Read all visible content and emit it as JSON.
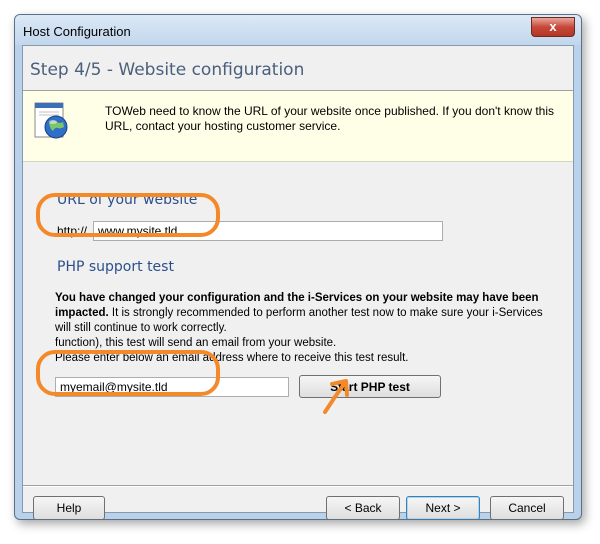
{
  "window": {
    "title": "Host Configuration",
    "close_glyph": "x"
  },
  "header": {
    "step_title": "Step 4/5 - Website configuration",
    "icon": "website-globe-icon",
    "info_text": "TOWeb need to know the URL of your website once published. If you don't know this URL, contact your hosting customer service."
  },
  "url_section": {
    "label": "URL of your website",
    "prefix": "http://",
    "value": "www.mysite.tld"
  },
  "php_section": {
    "label": "PHP support test",
    "text_bold": "You have changed your configuration and the i-Services on your website may have been impacted.",
    "text_rest": "It is strongly recommended to perform another test now to make sure your i-Services will still continue to work correctly.",
    "text_line4": "function), this test will send an email from your website.",
    "text_line5": "Please enter below an email address where to receive this test result.",
    "email_value": "myemail@mysite.tld",
    "test_button": "Start PHP test"
  },
  "footer": {
    "help": "Help",
    "back": "< Back",
    "next": "Next >",
    "cancel": "Cancel"
  },
  "colors": {
    "annotation": "#f4892a",
    "info_bg": "#ffffe8",
    "section_label": "#2c4f8c"
  }
}
